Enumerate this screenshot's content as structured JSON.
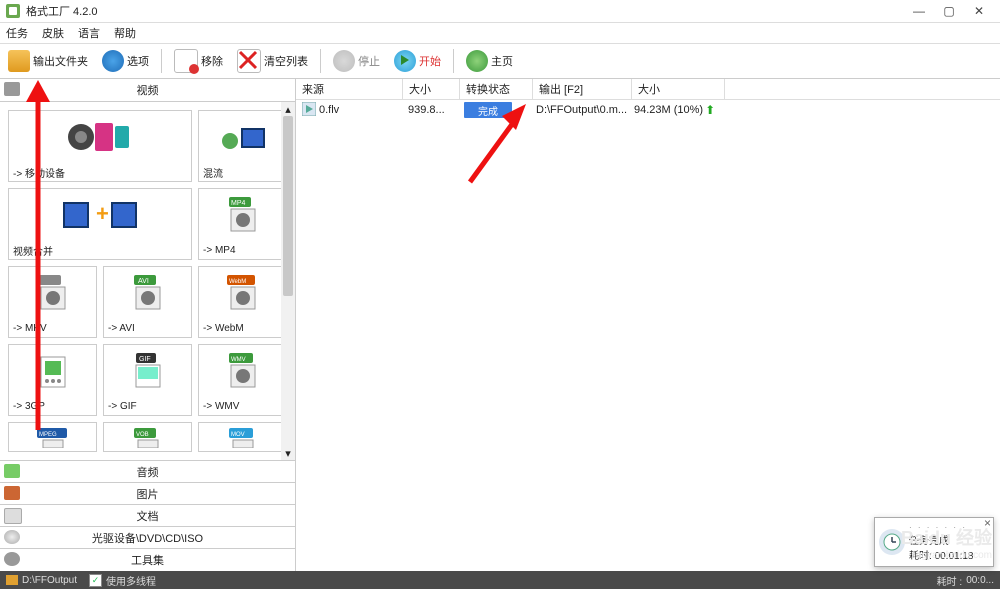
{
  "title": "格式工厂 4.2.0",
  "menus": [
    "任务",
    "皮肤",
    "语言",
    "帮助"
  ],
  "toolbar": {
    "output_folder": "输出文件夹",
    "options": "选项",
    "remove": "移除",
    "clear_list": "清空列表",
    "stop": "停止",
    "start": "开始",
    "home": "主页"
  },
  "video_label": "视频",
  "grid": {
    "mobile": "->  移动设备",
    "mix": "混流",
    "merge": "视频合并",
    "mp4": "-> MP4",
    "mkv": "-> MKV",
    "avi": "-> AVI",
    "webm": "-> WebM",
    "gp3": "-> 3GP",
    "gif": "-> GIF",
    "wmv": "-> WMV",
    "mpeg": "MPEG",
    "vob": "VOB",
    "mov": "MOV"
  },
  "badges": {
    "mp4": "MP4",
    "avi": "AVI",
    "webm": "WebM",
    "gif": "GIF",
    "wmv": "WMV",
    "mpeg": "MPEG",
    "vob": "VOB",
    "mov": "MOV"
  },
  "cats": {
    "audio": "音频",
    "image": "图片",
    "doc": "文档",
    "disc": "光驱设备\\DVD\\CD\\ISO",
    "tools": "工具集"
  },
  "list": {
    "head": {
      "src": "来源",
      "size": "大小",
      "state": "转换状态",
      "out": "输出 [F2]",
      "outsize": "大小"
    },
    "row": {
      "name": "0.flv",
      "size": "939.8...",
      "state": "完成",
      "out": "D:\\FFOutput\\0.m...",
      "outsize": "94.23M  (10%)"
    }
  },
  "status": {
    "folder": "D:\\FFOutput",
    "mt": "使用多线程",
    "time_label": "耗时 : ",
    "time_val": "00:0..."
  },
  "toast": {
    "title": "任务完成",
    "time_label": "耗时: ",
    "time_val": "00:01:18",
    "dots": "· · · · · · ·"
  },
  "watermark": {
    "line1": "Baidu 经验",
    "line2": "jingyan.baidu.com"
  }
}
